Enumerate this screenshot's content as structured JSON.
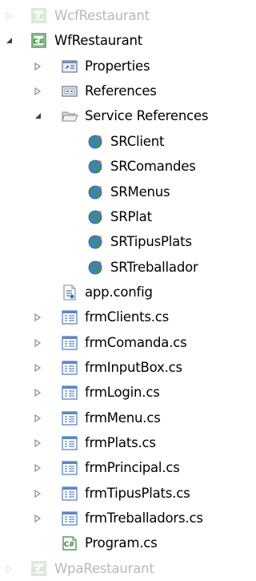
{
  "tree": {
    "top_project": {
      "label": "WcfRestaurant",
      "icon": "csharp-project-icon",
      "state": "collapsed"
    },
    "main_project": {
      "label": "WfRestaurant",
      "icon": "csharp-project-icon",
      "state": "expanded"
    },
    "properties": {
      "label": "Properties",
      "icon": "properties-icon"
    },
    "references": {
      "label": "References",
      "icon": "references-icon"
    },
    "service_references": {
      "label": "Service References",
      "icon": "folder-open-icon",
      "items": [
        {
          "label": "SRClient",
          "icon": "service-reference-globe-icon"
        },
        {
          "label": "SRComandes",
          "icon": "service-reference-globe-icon"
        },
        {
          "label": "SRMenus",
          "icon": "service-reference-globe-icon"
        },
        {
          "label": "SRPlat",
          "icon": "service-reference-globe-icon"
        },
        {
          "label": "SRTipusPlats",
          "icon": "service-reference-globe-icon"
        },
        {
          "label": "SRTreballador",
          "icon": "service-reference-globe-icon"
        }
      ]
    },
    "app_config": {
      "label": "app.config",
      "icon": "config-file-icon"
    },
    "forms": [
      {
        "label": "frmClients.cs",
        "icon": "form-icon"
      },
      {
        "label": "frmComanda.cs",
        "icon": "form-icon"
      },
      {
        "label": "frmInputBox.cs",
        "icon": "form-icon"
      },
      {
        "label": "frmLogin.cs",
        "icon": "form-icon"
      },
      {
        "label": "frmMenu.cs",
        "icon": "form-icon"
      },
      {
        "label": "frmPlats.cs",
        "icon": "form-icon"
      },
      {
        "label": "frmPrincipal.cs",
        "icon": "form-icon"
      },
      {
        "label": "frmTipusPlats.cs",
        "icon": "form-icon"
      },
      {
        "label": "frmTreballadors.cs",
        "icon": "form-icon"
      }
    ],
    "program": {
      "label": "Program.cs",
      "icon": "csharp-file-icon"
    },
    "bottom_project": {
      "label": "WpaRestaurant",
      "icon": "csharp-project-icon",
      "state": "collapsed"
    }
  },
  "colors": {
    "arrow_collapsed": "#a6a6a6",
    "arrow_expanded": "#404040",
    "csharp_green": "#2f8a2f",
    "form_blue": "#5b86c8",
    "globe_green": "#3c9a3c",
    "globe_blue": "#3f7fc6"
  }
}
